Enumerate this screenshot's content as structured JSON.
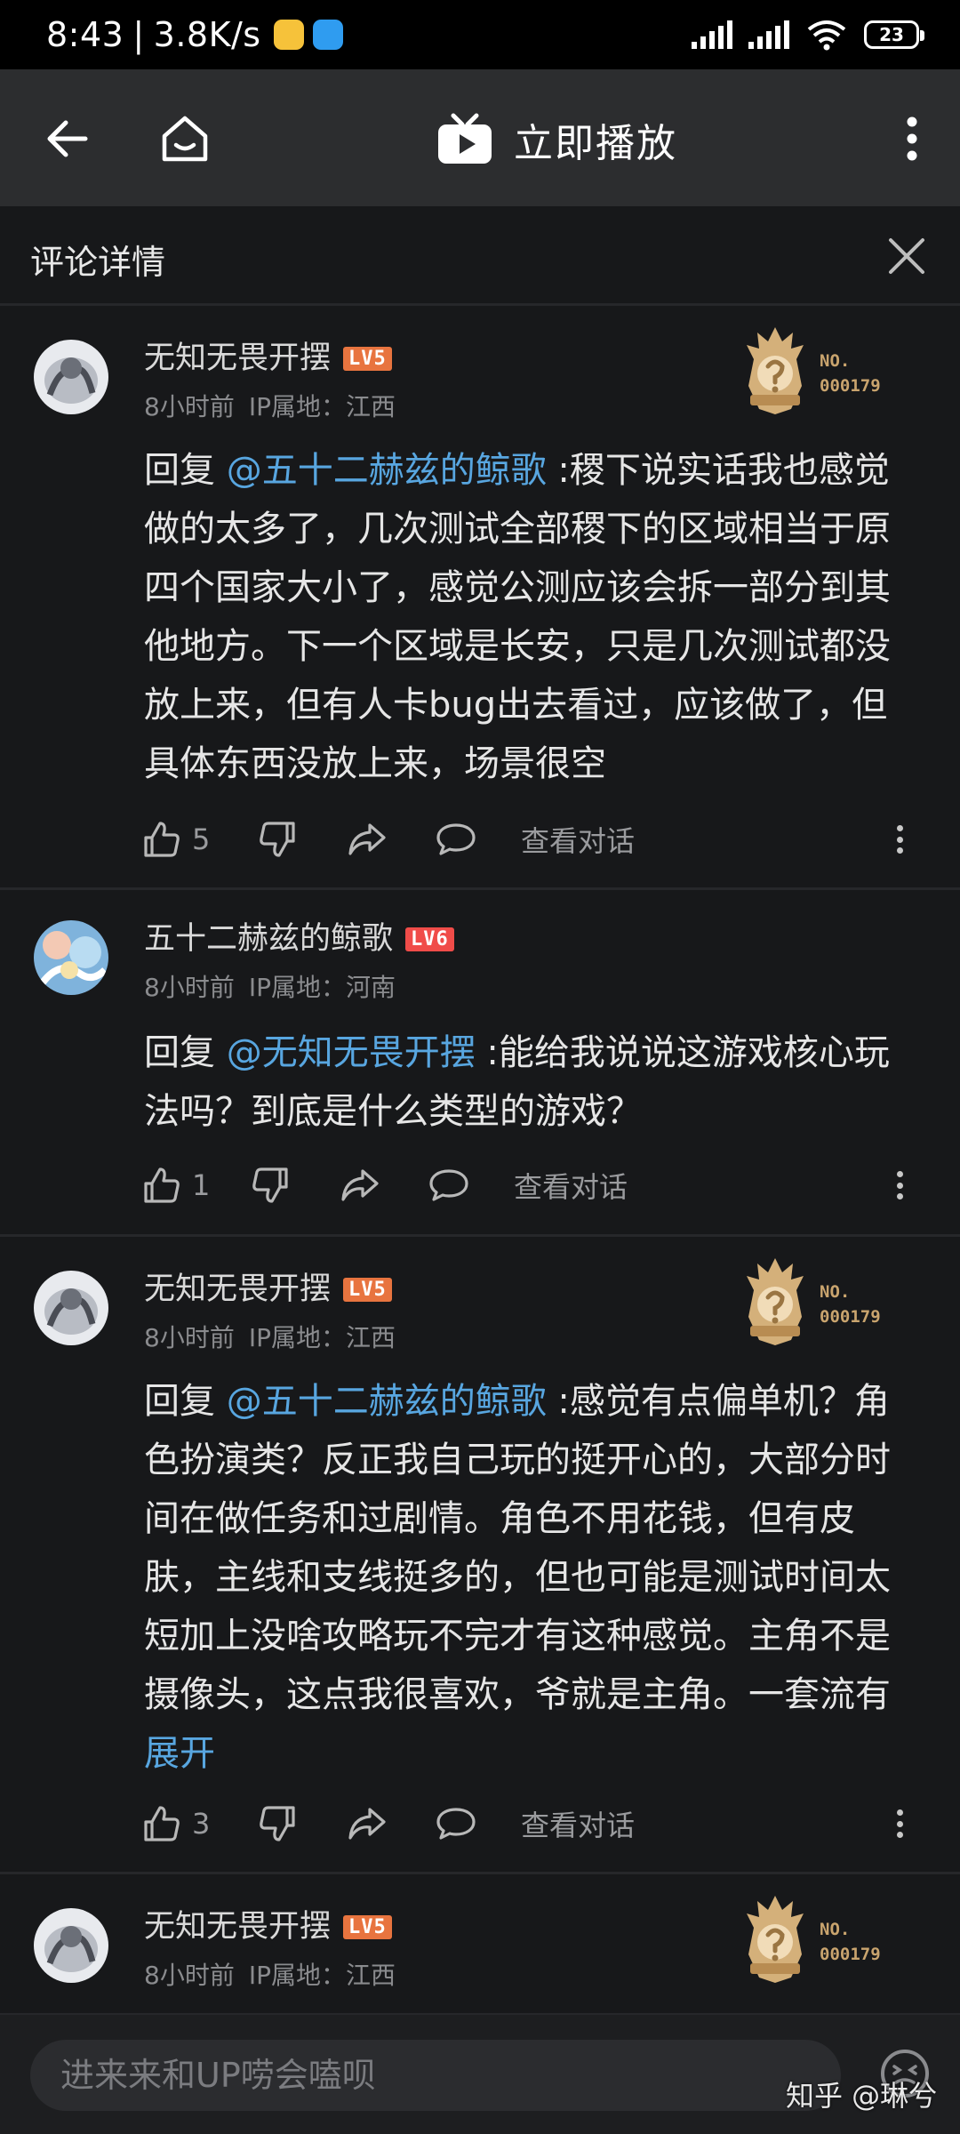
{
  "status_bar": {
    "time": "8:43",
    "network_speed": "3.8K/s",
    "battery": "23"
  },
  "nav": {
    "play_label": "立即播放"
  },
  "detail": {
    "title": "评论详情"
  },
  "comments": [
    {
      "username": "无知无畏开摆",
      "level": "LV5",
      "time": "8小时前",
      "ip": "IP属地：江西",
      "medal_no": "NO.",
      "medal_num": "000179",
      "reply_prefix": "回复 ",
      "mention": "@五十二赫兹的鲸歌",
      "text": " :稷下说实话我也感觉做的太多了，几次测试全部稷下的区域相当于原四个国家大小了，感觉公测应该会拆一部分到其他地方。下一个区域是长安，只是几次测试都没放上来，但有人卡bug出去看过，应该做了，但具体东西没放上来，场景很空",
      "likes": "5",
      "view_dialog": "查看对话"
    },
    {
      "username": "五十二赫兹的鲸歌",
      "level": "LV6",
      "time": "8小时前",
      "ip": "IP属地：河南",
      "reply_prefix": "回复 ",
      "mention": "@无知无畏开摆",
      "text": " :能给我说说这游戏核心玩法吗？到底是什么类型的游戏？",
      "likes": "1",
      "view_dialog": "查看对话"
    },
    {
      "username": "无知无畏开摆",
      "level": "LV5",
      "time": "8小时前",
      "ip": "IP属地：江西",
      "medal_no": "NO.",
      "medal_num": "000179",
      "reply_prefix": "回复 ",
      "mention": "@五十二赫兹的鲸歌",
      "text": " :感觉有点偏单机？角色扮演类？反正我自己玩的挺开心的，大部分时间在做任务和过剧情。角色不用花钱，但有皮肤，主线和支线挺多的，但也可能是测试时间太短加上没啥攻略玩不完才有这种感觉。主角不是摄像头，这点我很喜欢，爷就是主角。一套流有",
      "expand": "展开",
      "likes": "3",
      "view_dialog": "查看对话"
    },
    {
      "username": "无知无畏开摆",
      "level": "LV5",
      "time": "8小时前",
      "ip": "IP属地：江西",
      "medal_no": "NO.",
      "medal_num": "000179"
    }
  ],
  "input": {
    "placeholder": "进来来和UP唠会嗑呗"
  },
  "watermark": "知乎 @琳兮",
  "colors": {
    "background": "#17181a",
    "nav_background": "#2c2d2f",
    "mention": "#58a6e0",
    "lv5": "#e8743f",
    "lv6": "#f04c49",
    "medal_gold": "#c9a46e"
  }
}
